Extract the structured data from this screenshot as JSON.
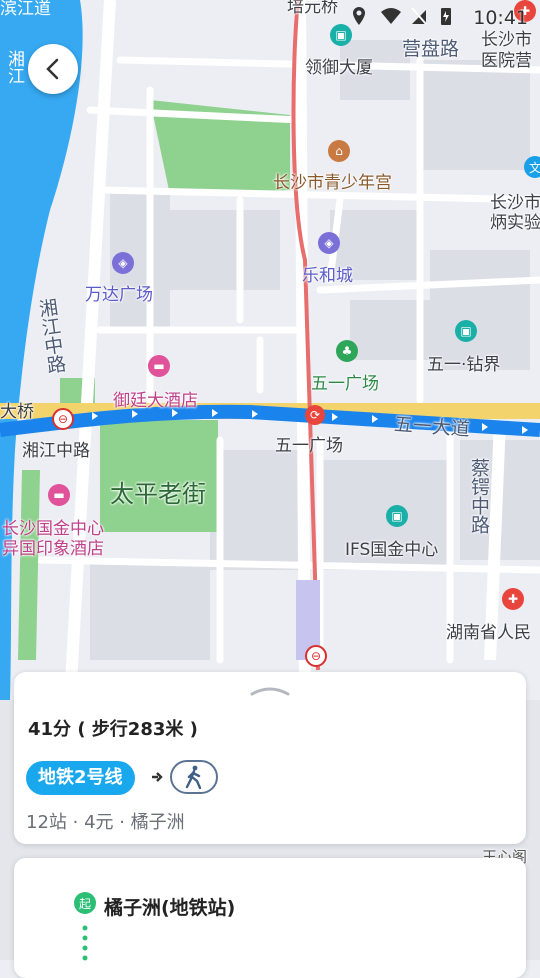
{
  "status_bar": {
    "time": "10:41"
  },
  "map": {
    "labels": {
      "peiyuan_bridge": "培元桥",
      "yingpan_road": "营盘路",
      "hospital": "长沙市\n医院营",
      "xiang_river": "湘江",
      "river_road_top": "滨江道",
      "lingyu_mansion": "领御大厦",
      "youth_palace": "长沙市青少年宫",
      "changsha_shi": "长沙市",
      "bingshi": "炳实验",
      "wanda": "万达广场",
      "leheicheng": "乐和城",
      "xiangjiang_middle_road": "湘江中路",
      "wuyi_zhujie": "五一·钻界",
      "wuyi_square_poi": "五一广场",
      "da_qiao": "大桥",
      "yuting_hotel": "御廷大酒店",
      "xiangjiang_station": "湘江中路",
      "wuyi_avenue": "五一大道",
      "wuyi_square_station": "五一广场",
      "caie_road": "蔡锷中路",
      "taiping_street": "太平老街",
      "guojin_center_hotel": "长沙国金中心",
      "yiguo_hotel": "异国印象酒店",
      "ifs": "IFS国金中心",
      "provincial_hospital": "湖南省人民",
      "bottom_right": "王心阁"
    }
  },
  "route_card": {
    "summary": "41分 ( 步行283米 )",
    "line_label": "地铁2号线",
    "details": "12站 · 4元 · 橘子洲"
  },
  "station_card": {
    "start_badge": "起",
    "station_name": "橘子洲(地铁站)"
  },
  "colors": {
    "metro_blue": "#19a8ee",
    "park_green": "#8fd18e",
    "water_blue": "#36a9f2",
    "start_green": "#2bbf76"
  }
}
